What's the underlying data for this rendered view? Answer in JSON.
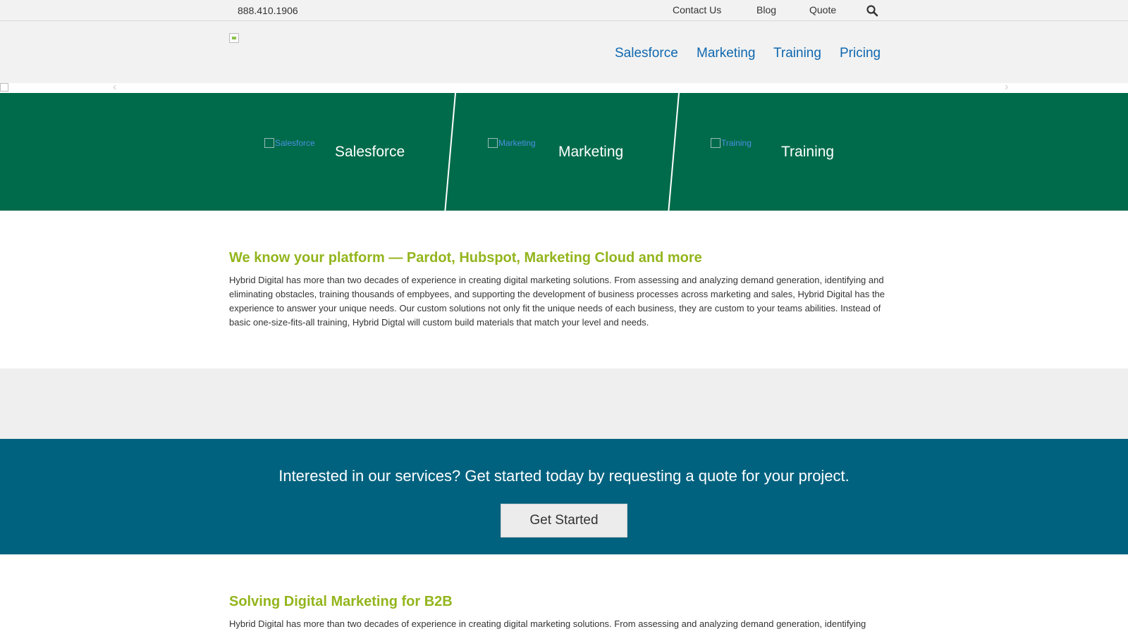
{
  "topbar": {
    "phone": "888.410.1906",
    "links": [
      "Contact Us",
      "Blog",
      "Quote"
    ],
    "search_icon": "search-icon"
  },
  "nav": {
    "items": [
      "Salesforce",
      "Marketing",
      "Training",
      "Pricing"
    ],
    "color": "#0f68b0"
  },
  "services": {
    "background": "#006b4a",
    "items": [
      {
        "img_alt": "Salesforce",
        "label": "Salesforce"
      },
      {
        "img_alt": "Marketing",
        "label": "Marketing"
      },
      {
        "img_alt": "Training",
        "label": "Training"
      }
    ]
  },
  "platform": {
    "heading": "We know your platform — Pardot, Hubspot, Marketing Cloud and more",
    "body": "Hybrid Digital has more than two decades of experience in creating digital marketing solutions. From assessing and analyzing demand generation, identifying and eliminating obstacles, training thousands of empbyees, and supporting the development of business processes across marketing and sales, Hybrid Digital has the experience to answer your unique needs. Our custom solutions not only fit the unique needs of each business, they are custom to your teams abilities. Instead of basic one-size-fits-all training, Hybrid Digtal will custom build materials that match your level and needs."
  },
  "cta": {
    "text": "Interested in our services? Get started today by requesting a quote for your project.",
    "button_label": "Get Started",
    "background": "#00627f"
  },
  "b2b": {
    "heading": "Solving Digital Marketing for B2B",
    "body": "Hybrid Digital has more than two decades of experience in creating digital marketing solutions. From assessing and analyzing demand generation, identifying"
  },
  "colors": {
    "heading_green": "#93b51c"
  }
}
